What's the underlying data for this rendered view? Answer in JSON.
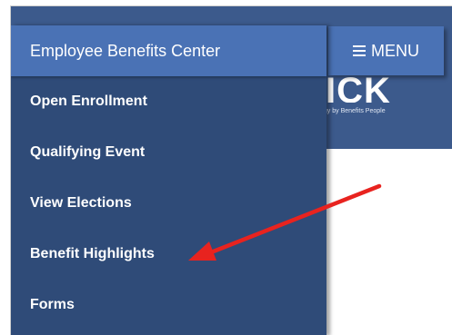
{
  "header": {
    "menu_label": "MENU",
    "logo_text": "ICK",
    "logo_tagline": "ogy by Benefits People"
  },
  "drawer": {
    "title": "Employee Benefits Center",
    "items": [
      {
        "label": "Open Enrollment"
      },
      {
        "label": "Qualifying Event"
      },
      {
        "label": "View Elections"
      },
      {
        "label": "Benefit Highlights"
      },
      {
        "label": "Forms"
      }
    ]
  },
  "annotation": {
    "arrow_color": "#e8231f",
    "points_to": "Benefit Highlights"
  },
  "colors": {
    "drawer_bg": "#2f4b78",
    "accent": "#4a72b5",
    "header_bg": "#3c5a8c"
  }
}
